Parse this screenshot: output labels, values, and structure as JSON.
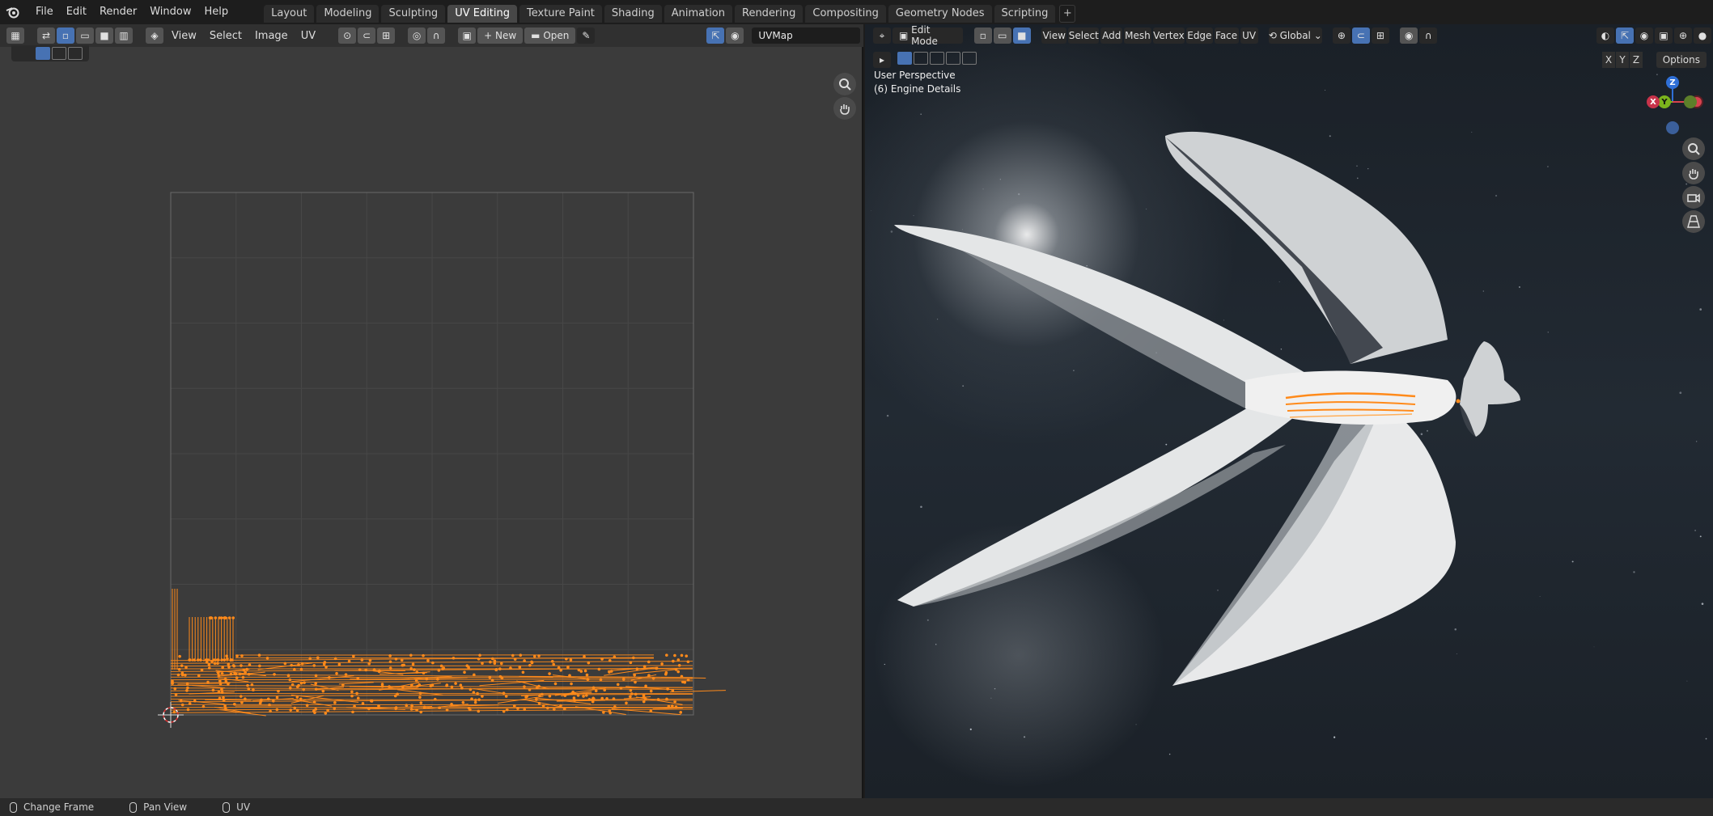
{
  "menu": {
    "items": [
      "File",
      "Edit",
      "Render",
      "Window",
      "Help"
    ]
  },
  "workspaces": {
    "tabs": [
      "Layout",
      "Modeling",
      "Sculpting",
      "UV Editing",
      "Texture Paint",
      "Shading",
      "Animation",
      "Rendering",
      "Compositing",
      "Geometry Nodes",
      "Scripting"
    ],
    "active": "UV Editing",
    "add_symbol": "+"
  },
  "uv_editor": {
    "menus": [
      "View",
      "Select",
      "Image",
      "UV"
    ],
    "new_label": "New",
    "open_label": "Open",
    "uvmap_name": "UVMap"
  },
  "viewport": {
    "mode": "Edit Mode",
    "menus": [
      "View",
      "Select",
      "Add",
      "Mesh",
      "Vertex",
      "Edge",
      "Face",
      "UV"
    ],
    "orientation": "Global",
    "perspective": "User Perspective",
    "object_label": "(6) Engine Details",
    "axis_buttons": [
      "X",
      "Y",
      "Z"
    ],
    "options_label": "Options",
    "gizmo": {
      "z": "Z",
      "y": "Y",
      "x": "X"
    }
  },
  "statusbar": {
    "items": [
      "Change Frame",
      "Pan View",
      "UV"
    ]
  },
  "colors": {
    "accent": "#4772b3",
    "uv_orange": "#ff8a1a",
    "header_bg": "#303030",
    "editor_bg": "#3b3b3b"
  }
}
